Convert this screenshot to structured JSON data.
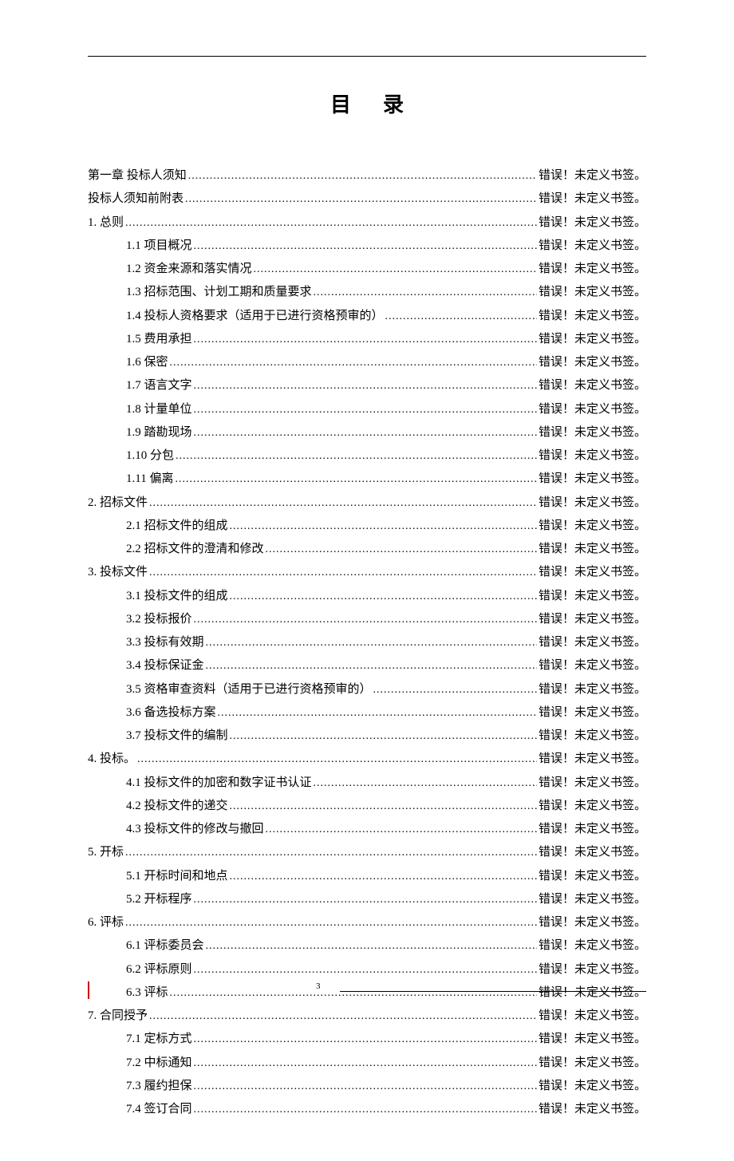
{
  "title": "目录",
  "error_text": "错误！未定义书签。",
  "page_number": "3",
  "toc": [
    {
      "level": 0,
      "label": "第一章 投标人须知"
    },
    {
      "level": 1,
      "label": "投标人须知前附表"
    },
    {
      "level": 1,
      "label": "1. 总则"
    },
    {
      "level": 2,
      "label": "1.1  项目概况"
    },
    {
      "level": 2,
      "label": "1.2  资金来源和落实情况"
    },
    {
      "level": 2,
      "label": "1.3  招标范围、计划工期和质量要求"
    },
    {
      "level": 2,
      "label": "1.4  投标人资格要求（适用于已进行资格预审的）"
    },
    {
      "level": 2,
      "label": "1.5  费用承担"
    },
    {
      "level": 2,
      "label": "1.6  保密"
    },
    {
      "level": 2,
      "label": "1.7  语言文字"
    },
    {
      "level": 2,
      "label": "1.8  计量单位"
    },
    {
      "level": 2,
      "label": "1.9  踏勘现场"
    },
    {
      "level": 2,
      "label": "1.10  分包"
    },
    {
      "level": 2,
      "label": "1.11  偏离"
    },
    {
      "level": 1,
      "label": "2. 招标文件"
    },
    {
      "level": 2,
      "label": "2.1  招标文件的组成"
    },
    {
      "level": 2,
      "label": "2.2  招标文件的澄清和修改"
    },
    {
      "level": 1,
      "label": "3. 投标文件"
    },
    {
      "level": 2,
      "label": "3.1  投标文件的组成"
    },
    {
      "level": 2,
      "label": "3.2  投标报价"
    },
    {
      "level": 2,
      "label": "3.3  投标有效期"
    },
    {
      "level": 2,
      "label": "3.4  投标保证金"
    },
    {
      "level": 2,
      "label": "3.5  资格审查资料（适用于已进行资格预审的）"
    },
    {
      "level": 2,
      "label": "3.6  备选投标方案"
    },
    {
      "level": 2,
      "label": "3.7  投标文件的编制"
    },
    {
      "level": 1,
      "label": "4. 投标。"
    },
    {
      "level": 2,
      "label": "4.1  投标文件的加密和数字证书认证"
    },
    {
      "level": 2,
      "label": "4.2  投标文件的递交"
    },
    {
      "level": 2,
      "label": "4.3  投标文件的修改与撤回"
    },
    {
      "level": 1,
      "label": "5. 开标"
    },
    {
      "level": 2,
      "label": "5.1  开标时间和地点"
    },
    {
      "level": 2,
      "label": "5.2  开标程序"
    },
    {
      "level": 1,
      "label": "6. 评标"
    },
    {
      "level": 2,
      "label": "6.1  评标委员会"
    },
    {
      "level": 2,
      "label": "6.2  评标原则"
    },
    {
      "level": 2,
      "label": "6.3  评标"
    },
    {
      "level": 1,
      "label": "7. 合同授予"
    },
    {
      "level": 2,
      "label": "7.1  定标方式"
    },
    {
      "level": 2,
      "label": "7.2  中标通知"
    },
    {
      "level": 2,
      "label": "7.3  履约担保"
    },
    {
      "level": 2,
      "label": "7.4  签订合同"
    }
  ]
}
